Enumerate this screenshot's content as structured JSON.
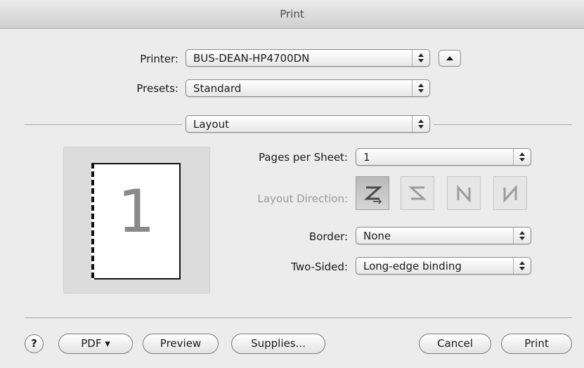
{
  "window": {
    "title": "Print"
  },
  "printer": {
    "label": "Printer:",
    "value": "BUS-DEAN-HP4700DN",
    "toggle_icon": "triangle-up-icon"
  },
  "presets": {
    "label": "Presets:",
    "value": "Standard"
  },
  "section": {
    "value": "Layout"
  },
  "preview": {
    "page_number": "1"
  },
  "layout": {
    "pages_per_sheet": {
      "label": "Pages per Sheet:",
      "value": "1"
    },
    "direction": {
      "label": "Layout Direction:",
      "options": [
        "z-order-icon",
        "reverse-z-order-icon",
        "n-order-icon",
        "reverse-n-order-icon"
      ],
      "selected": 0
    },
    "border": {
      "label": "Border:",
      "value": "None"
    },
    "two_sided": {
      "label": "Two-Sided:",
      "value": "Long-edge binding"
    }
  },
  "footer": {
    "help_label": "?",
    "pdf_label": "PDF ▾",
    "preview_label": "Preview",
    "supplies_label": "Supplies...",
    "cancel_label": "Cancel",
    "print_label": "Print"
  },
  "colors": {
    "background": "#ececec",
    "selected_direction": "#bdbdbd",
    "disabled_text": "#9a9a9a"
  }
}
